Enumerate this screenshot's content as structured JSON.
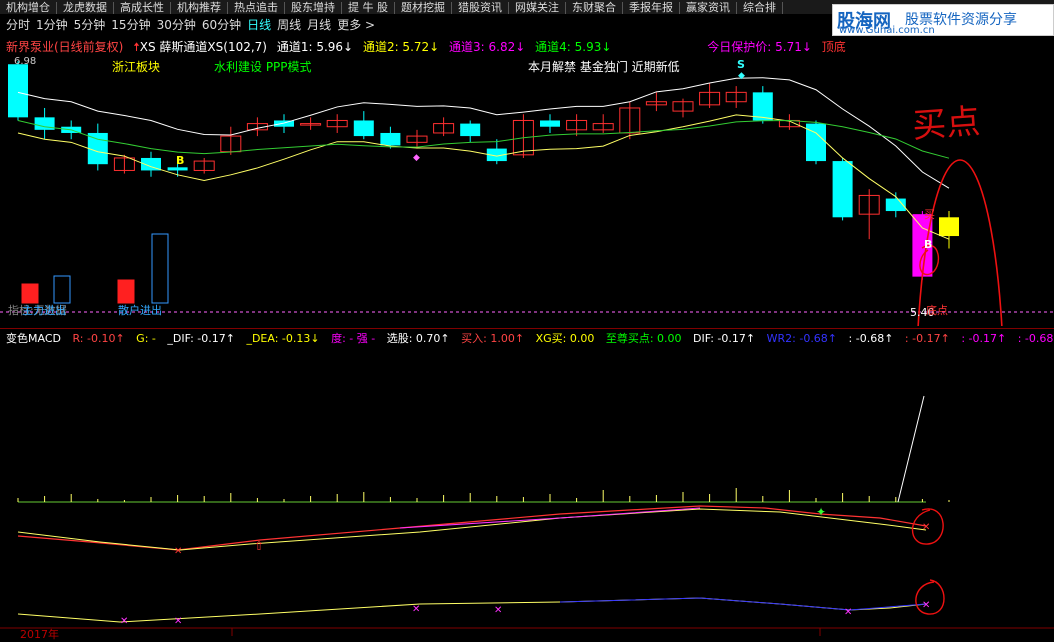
{
  "nav": {
    "items": [
      "机构增仓",
      "龙虎数据",
      "高成长性",
      "机构推荐",
      "热点追击",
      "股东增持",
      "提 牛 股",
      "题材挖掘",
      "猎股资讯",
      "网媒关注",
      "东财聚合",
      "季报年报",
      "赢家资讯",
      "综合排"
    ]
  },
  "logo": {
    "site": "股海网",
    "slogan": "股票软件资源分享",
    "url": "www.Guhai.com.cn"
  },
  "periods": {
    "items": [
      "分时",
      "1分钟",
      "5分钟",
      "15分钟",
      "30分钟",
      "60分钟",
      "日线",
      "周线",
      "月线",
      "更多 >"
    ],
    "active": "日线"
  },
  "info": {
    "stock": "新界泵业(日线前复权)",
    "indicator": "XS 薛斯通道XS(102,7)",
    "ch1": "通道1: 5.96↓",
    "ch2": "通道2: 5.72↓",
    "ch3": "通道3: 6.82↓",
    "ch4": "通道4: 5.93↓",
    "protect": "今日保护价: 5.71↓",
    "extra": "顶底"
  },
  "annotations": {
    "zhejiang": "浙江板块",
    "water": "水利建设 PPP模式",
    "news": "本月解禁 基金独门 近期新低",
    "peak_val": "6.98",
    "low_val": "5.40",
    "retail": "散户进出",
    "main_fund": "主力进出",
    "indicator_note": "指标:无数据",
    "buy": "买",
    "bottom": "底点",
    "B": "B",
    "S": "S",
    "handwriting": "买点",
    "year": "2017年"
  },
  "macd": {
    "name": "变色MACD",
    "r": "R: -0.10↑",
    "g": "G: -",
    "dif1": "_DIF: -0.17↑",
    "dea": "_DEA: -0.13↓",
    "du": "度: - 强 -",
    "xuangu": "选股: 0.70↑",
    "mairu": "买入: 1.00↑",
    "xgmai": "XG买: 0.00",
    "zhizun": "至尊买点: 0.00",
    "dif2": "DIF: -0.17↑",
    "wr2": "WR2: -0.68↑",
    "v1": ": -0.68↑",
    "v2": ": -0.17↑",
    "v3": ": -0.17↑",
    "v4": ": -0.68"
  },
  "candles": [
    [
      6.98,
      6.64,
      7.0,
      6.62
    ],
    [
      6.64,
      6.56,
      6.7,
      6.5
    ],
    [
      6.58,
      6.54,
      6.62,
      6.5
    ],
    [
      6.54,
      6.34,
      6.6,
      6.3
    ],
    [
      6.3,
      6.38,
      6.4,
      6.28
    ],
    [
      6.38,
      6.3,
      6.42,
      6.26
    ],
    [
      6.32,
      6.3,
      6.38,
      6.26
    ],
    [
      6.3,
      6.36,
      6.38,
      6.28
    ],
    [
      6.42,
      6.52,
      6.58,
      6.4
    ],
    [
      6.56,
      6.6,
      6.64,
      6.52
    ],
    [
      6.62,
      6.58,
      6.66,
      6.54
    ],
    [
      6.6,
      6.6,
      6.64,
      6.56
    ],
    [
      6.58,
      6.62,
      6.66,
      6.54
    ],
    [
      6.62,
      6.52,
      6.68,
      6.5
    ],
    [
      6.54,
      6.46,
      6.58,
      6.44
    ],
    [
      6.48,
      6.52,
      6.56,
      6.44
    ],
    [
      6.54,
      6.6,
      6.64,
      6.52
    ],
    [
      6.6,
      6.52,
      6.62,
      6.48
    ],
    [
      6.44,
      6.36,
      6.5,
      6.34
    ],
    [
      6.4,
      6.62,
      6.66,
      6.38
    ],
    [
      6.62,
      6.58,
      6.66,
      6.54
    ],
    [
      6.56,
      6.62,
      6.66,
      6.52
    ],
    [
      6.56,
      6.6,
      6.66,
      6.54
    ],
    [
      6.54,
      6.7,
      6.74,
      6.5
    ],
    [
      6.72,
      6.74,
      6.8,
      6.68
    ],
    [
      6.68,
      6.74,
      6.76,
      6.64
    ],
    [
      6.72,
      6.8,
      6.86,
      6.7
    ],
    [
      6.74,
      6.8,
      6.84,
      6.7
    ],
    [
      6.8,
      6.62,
      6.84,
      6.6
    ],
    [
      6.58,
      6.62,
      6.66,
      6.56
    ],
    [
      6.6,
      6.36,
      6.62,
      6.34
    ],
    [
      6.36,
      6.0,
      6.38,
      5.98
    ],
    [
      6.02,
      6.14,
      6.18,
      5.86
    ],
    [
      6.12,
      6.04,
      6.16,
      6.0
    ],
    [
      6.02,
      5.62,
      6.04,
      5.6
    ],
    [
      5.88,
      6.0,
      6.04,
      5.8
    ]
  ]
}
